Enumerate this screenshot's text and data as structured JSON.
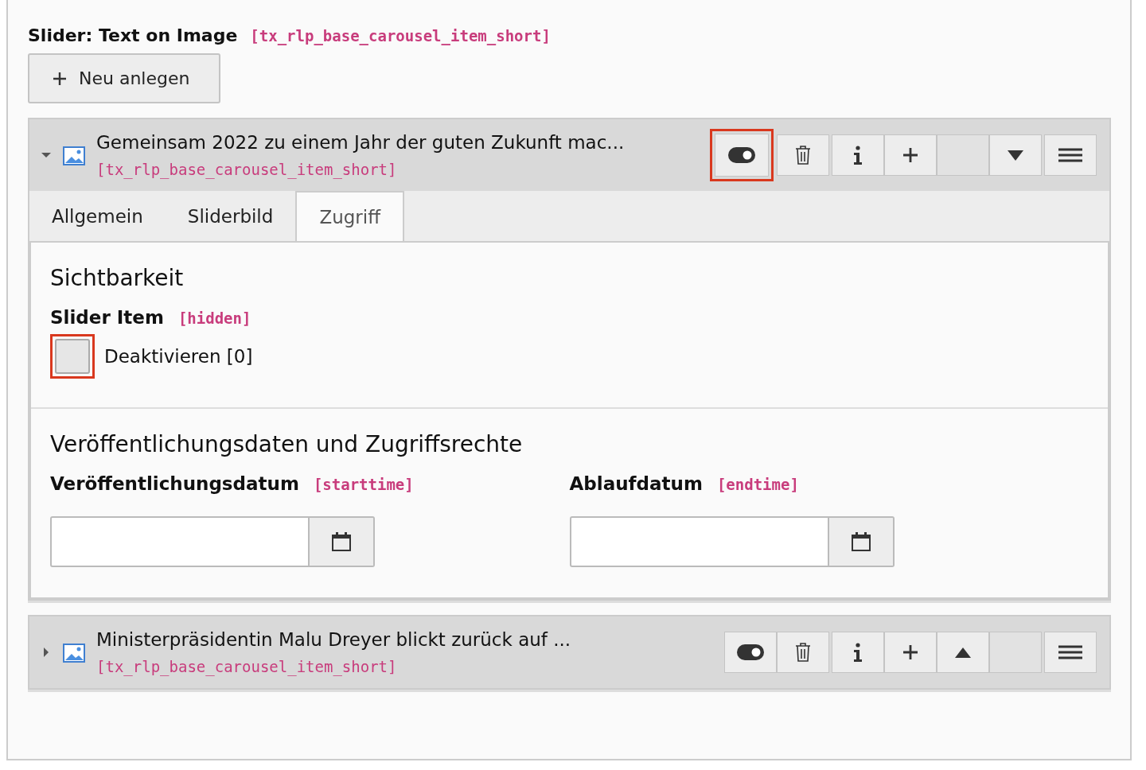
{
  "section": {
    "title": "Slider: Text on Image",
    "field": "[tx_rlp_base_carousel_item_short]"
  },
  "new_button": {
    "label": "Neu anlegen"
  },
  "items": [
    {
      "title": "Gemeinsam 2022 zu einem Jahr der guten Zukunft mac...",
      "table": "[tx_rlp_base_carousel_item_short]",
      "expanded": true,
      "actions": [
        {
          "kind": "toggle",
          "highlighted": true
        },
        {
          "kind": "delete",
          "highlighted": false
        },
        {
          "kind": "info",
          "highlighted": false
        },
        {
          "kind": "new",
          "highlighted": false
        },
        {
          "kind": "blank",
          "highlighted": false
        },
        {
          "kind": "down",
          "highlighted": false
        },
        {
          "kind": "drag",
          "highlighted": false
        }
      ],
      "tabs": [
        {
          "label": "Allgemein",
          "selected": false
        },
        {
          "label": "Sliderbild",
          "selected": false
        },
        {
          "label": "Zugriff",
          "selected": true
        }
      ],
      "sections": [
        {
          "kind": "checkbox",
          "title": "Sichtbarkeit",
          "field_label": "Slider Item",
          "field_name": "[hidden]",
          "checkbox_label": "Deaktivieren [0]",
          "checked": false,
          "highlighted": true
        },
        {
          "kind": "dates",
          "title": "Veröffentlichungsdaten und Zugriffsrechte",
          "fields": [
            {
              "label": "Veröffentlichungsdatum",
              "name": "[starttime]"
            },
            {
              "label": "Ablaufdatum",
              "name": "[endtime]"
            }
          ]
        }
      ]
    },
    {
      "title": "Ministerpräsidentin Malu Dreyer blickt zurück auf ...",
      "table": "[tx_rlp_base_carousel_item_short]",
      "expanded": false,
      "actions": [
        {
          "kind": "toggle",
          "highlighted": false
        },
        {
          "kind": "delete",
          "highlighted": false
        },
        {
          "kind": "info",
          "highlighted": false
        },
        {
          "kind": "new",
          "highlighted": false
        },
        {
          "kind": "up",
          "highlighted": false
        },
        {
          "kind": "blank",
          "highlighted": false
        },
        {
          "kind": "drag",
          "highlighted": false
        }
      ]
    }
  ]
}
